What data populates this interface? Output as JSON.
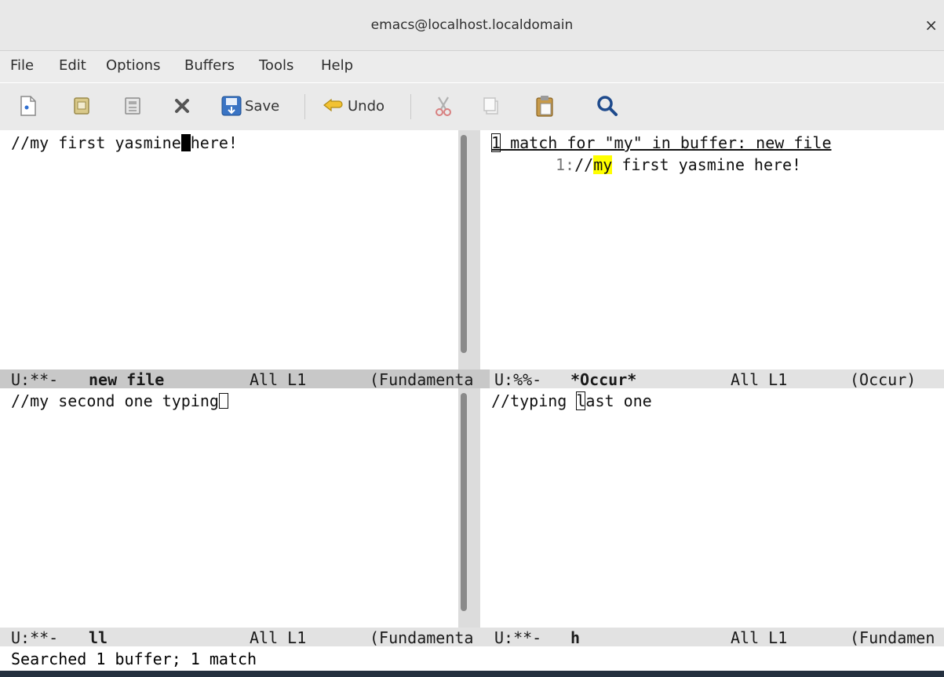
{
  "window": {
    "title": "emacs@localhost.localdomain",
    "close_glyph": "×"
  },
  "menubar": {
    "items": [
      "File",
      "Edit",
      "Options",
      "Buffers",
      "Tools",
      "Help"
    ]
  },
  "toolbar": {
    "buttons": [
      {
        "name": "new-file-icon"
      },
      {
        "name": "open-file-icon"
      },
      {
        "name": "dired-icon"
      },
      {
        "name": "close-buffer-icon"
      },
      {
        "name": "save-icon",
        "label": "Save"
      },
      {
        "name": "undo-icon",
        "label": "Undo"
      },
      {
        "name": "cut-icon"
      },
      {
        "name": "copy-icon"
      },
      {
        "name": "paste-icon"
      },
      {
        "name": "search-icon"
      }
    ],
    "save_label": "Save",
    "undo_label": "Undo"
  },
  "panes": {
    "top_left": {
      "text_before_cursor": "//my first yasmine",
      "text_after_cursor": "here!",
      "modeline": {
        "status": "U:**-",
        "buffer": "new file",
        "position": "All L1",
        "mode": "(Fundamenta"
      }
    },
    "top_right": {
      "header_count": "1",
      "header_rest": " match for \"my\" in buffer: new file",
      "line_number": "1:",
      "line_prefix": "//",
      "line_match": "my",
      "line_rest": " first yasmine here!",
      "modeline": {
        "status": "U:%%-",
        "buffer": "*Occur*",
        "position": "All L1",
        "mode": "(Occur)"
      }
    },
    "bottom_left": {
      "text": "//my second one typing",
      "modeline": {
        "status": "U:**-",
        "buffer": "ll",
        "position": "All L1",
        "mode": "(Fundamenta"
      }
    },
    "bottom_right": {
      "text_before_cursor": "//typing ",
      "cursor_char": "l",
      "text_after_cursor": "ast one",
      "modeline": {
        "status": "U:**-",
        "buffer": "h",
        "position": "All L1",
        "mode": "(Fundamen"
      }
    }
  },
  "echo_area": {
    "message": "Searched 1 buffer; 1 match"
  },
  "colors": {
    "match_highlight": "#ffff00",
    "modeline_active": "#c8c8c8",
    "modeline_inactive": "#e2e2e2"
  }
}
